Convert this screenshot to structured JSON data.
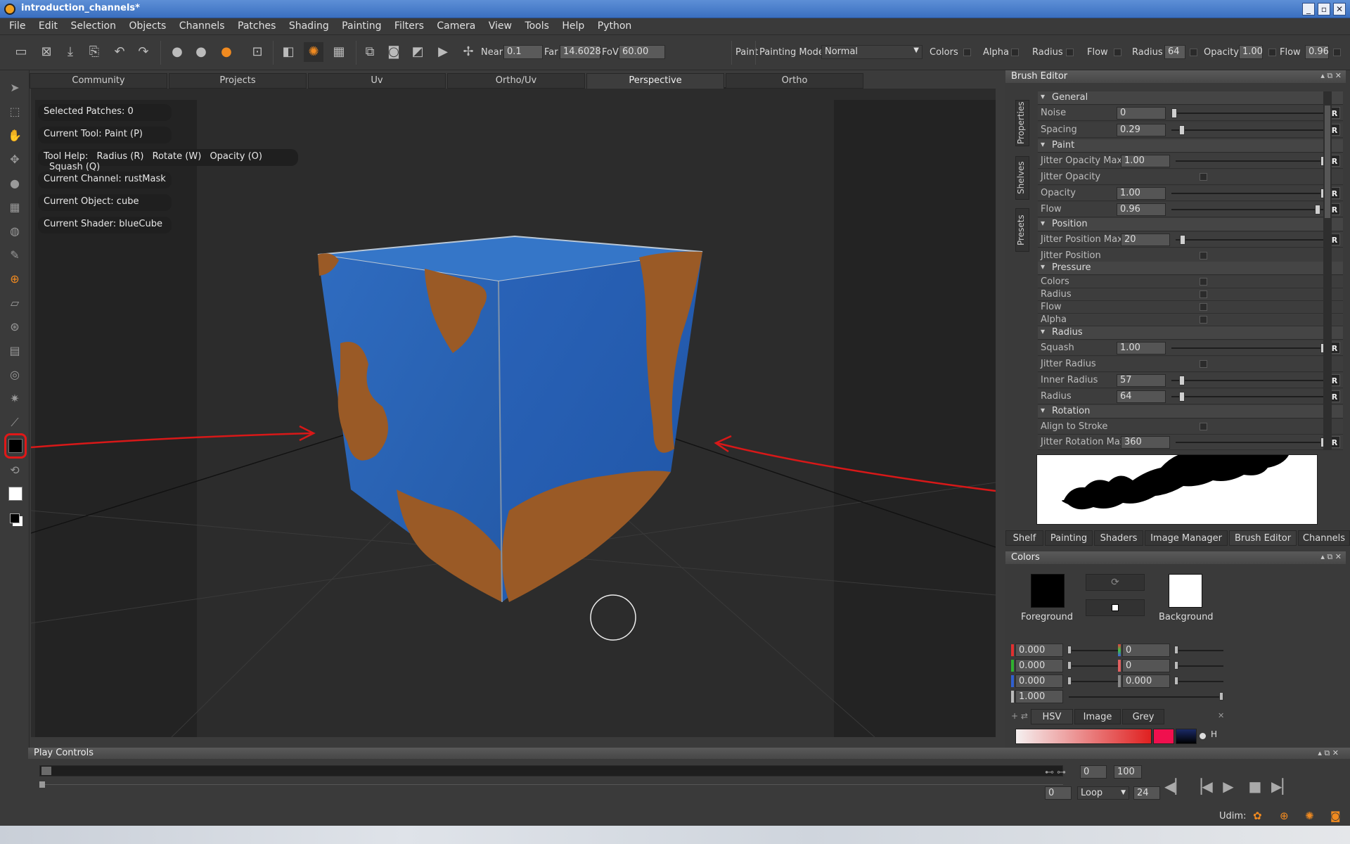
{
  "window": {
    "title": "introduction_channels*",
    "controls": [
      "_",
      "▫",
      "✕"
    ]
  },
  "menu": [
    "File",
    "Edit",
    "Selection",
    "Objects",
    "Channels",
    "Patches",
    "Shading",
    "Painting",
    "Filters",
    "Camera",
    "View",
    "Tools",
    "Help",
    "Python"
  ],
  "toolbar": {
    "near_label": "Near",
    "near_value": "0.1",
    "far_label": "Far",
    "far_value": "14.6028",
    "fov_label": "FoV",
    "fov_value": "60.00",
    "paint_label": "Paint",
    "painting_mode_label": "Painting Mode",
    "painting_mode_value": "Normal",
    "colors_label": "Colors",
    "alpha_label": "Alpha",
    "radius_label": "Radius",
    "flow_label": "Flow",
    "radius2_label": "Radius",
    "radius2_value": "64",
    "opacity_label": "Opacity",
    "opacity_value": "1.00",
    "flow2_label": "Flow",
    "flow2_value": "0.96"
  },
  "view_tabs": [
    "Community",
    "Projects",
    "Uv",
    "Ortho/Uv",
    "Perspective",
    "Ortho"
  ],
  "active_view_tab": "Perspective",
  "hud": {
    "selected_patches": "Selected Patches: 0",
    "current_tool": "Current Tool: Paint (P)",
    "tool_help_label": "Tool Help:",
    "tool_help_items": [
      "Radius (R)",
      "Rotate (W)",
      "Opacity (O)",
      "Squash (Q)"
    ],
    "current_channel": "Current Channel: rustMask",
    "current_object": "Current Object: cube",
    "current_shader": "Current Shader: blueCube"
  },
  "brush_editor": {
    "title": "Brush Editor",
    "side_tabs": [
      "Properties",
      "Shelves",
      "Presets"
    ],
    "sections": {
      "general": "General",
      "paint": "Paint",
      "position": "Position",
      "pressure": "Pressure",
      "radius": "Radius",
      "rotation": "Rotation"
    },
    "rows": {
      "noise": {
        "label": "Noise",
        "value": "0",
        "level": 0.0
      },
      "spacing": {
        "label": "Spacing",
        "value": "0.29",
        "level": 0.05
      },
      "jitter_opacity_max": {
        "label": "Jitter Opacity Max",
        "value": "1.00",
        "level": 1.0
      },
      "jitter_opacity": {
        "label": "Jitter Opacity"
      },
      "opacity": {
        "label": "Opacity",
        "value": "1.00",
        "level": 1.0
      },
      "flow": {
        "label": "Flow",
        "value": "0.96",
        "level": 0.96
      },
      "jitter_position_max": {
        "label": "Jitter Position Max",
        "value": "20",
        "level": 0.03
      },
      "jitter_position": {
        "label": "Jitter Position"
      },
      "p_colors": {
        "label": "Colors"
      },
      "p_radius": {
        "label": "Radius"
      },
      "p_flow": {
        "label": "Flow"
      },
      "p_alpha": {
        "label": "Alpha"
      },
      "squash": {
        "label": "Squash",
        "value": "1.00",
        "level": 1.0
      },
      "jitter_radius": {
        "label": "Jitter Radius"
      },
      "inner_radius": {
        "label": "Inner Radius",
        "value": "57",
        "level": 0.05
      },
      "radius": {
        "label": "Radius",
        "value": "64",
        "level": 0.05
      },
      "align_to_stroke": {
        "label": "Align to Stroke"
      },
      "jitter_rotation_max": {
        "label": "Jitter Rotation Max",
        "value": "360",
        "level": 1.0
      }
    },
    "reset_label": "R"
  },
  "dock_tabs": [
    "Shelf",
    "Painting",
    "Shaders",
    "Image Manager",
    "Brush Editor",
    "Channels"
  ],
  "active_dock_tab": "Brush Editor",
  "colors_panel": {
    "title": "Colors",
    "foreground_label": "Foreground",
    "background_label": "Background",
    "foreground_color": "#000000",
    "background_color": "#ffffff",
    "rgb": [
      "0.000",
      "0.000",
      "0.000",
      "1.000"
    ],
    "hsv": [
      "0",
      "0",
      "0.000"
    ],
    "tabs": [
      "HSV",
      "Image",
      "Grey"
    ],
    "active_tab": "HSV",
    "h_label": "H"
  },
  "play_controls": {
    "title": "Play Controls",
    "start": "0",
    "end": "100",
    "current": "0",
    "loop_value": "Loop",
    "fps": "24"
  },
  "status": {
    "udim_label": "Udim:"
  }
}
